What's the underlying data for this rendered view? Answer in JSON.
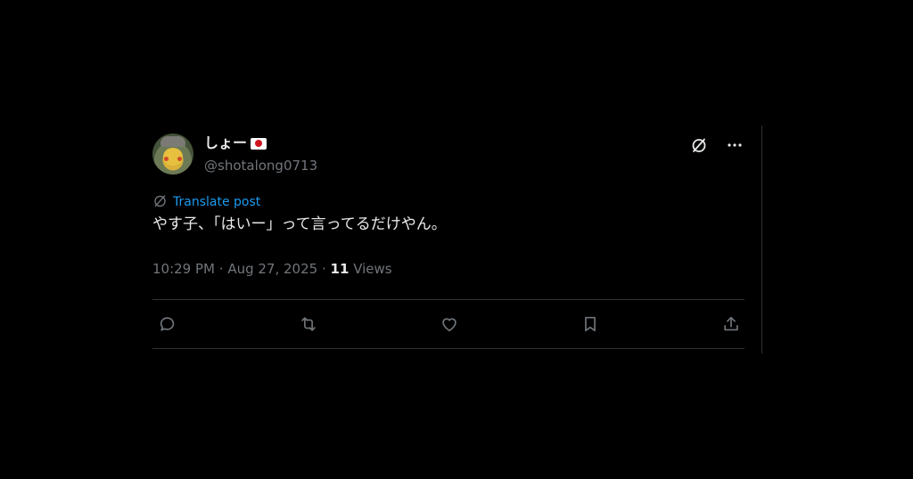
{
  "user": {
    "display_name": "しょー",
    "handle": "@shotalong0713"
  },
  "post": {
    "translate_label": "Translate post",
    "text": "やす子、「はいー」って言ってるだけやん。"
  },
  "meta": {
    "time": "10:29 PM",
    "separator": "·",
    "date": "Aug 27, 2025",
    "views_count": "11",
    "views_label": "Views"
  },
  "icons": {
    "grok": "grok-icon",
    "more": "more-icon",
    "translate": "globe-icon",
    "reply": "reply-icon",
    "repost": "repost-icon",
    "like": "like-icon",
    "bookmark": "bookmark-icon",
    "share": "share-icon"
  },
  "colors": {
    "background": "#000000",
    "text": "#e7e9ea",
    "muted": "#71767b",
    "accent": "#1d9bf0",
    "divider": "#2f3336"
  }
}
